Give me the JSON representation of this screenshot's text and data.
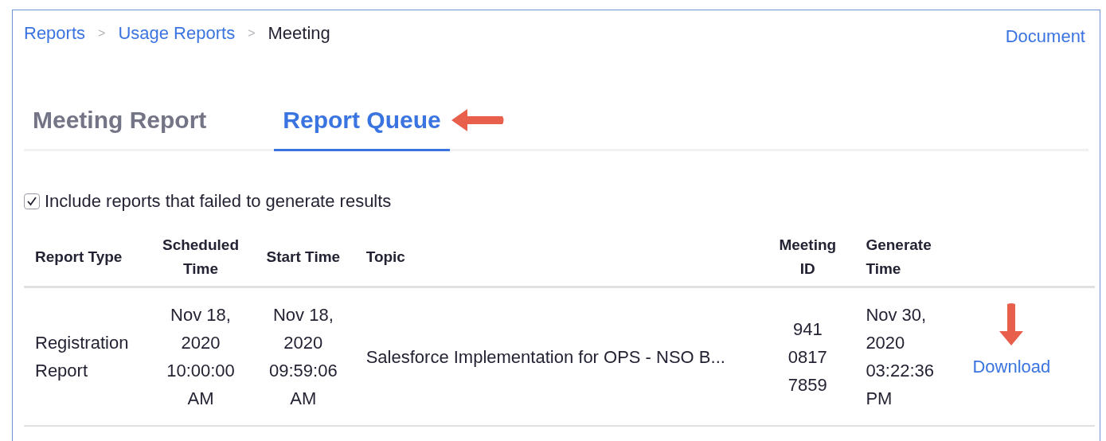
{
  "breadcrumb": [
    {
      "label": "Reports",
      "kind": "link"
    },
    {
      "label": "Usage Reports",
      "kind": "link"
    },
    {
      "label": "Meeting",
      "kind": "current"
    }
  ],
  "separator": ">",
  "document_link": "Document",
  "tabs": [
    {
      "label": "Meeting Report",
      "selected": false
    },
    {
      "label": "Report Queue",
      "selected": true
    }
  ],
  "include_failed": {
    "label": "Include reports that failed to generate results",
    "checked": true
  },
  "table": {
    "columns": [
      "Report Type",
      "Scheduled Time",
      "Start Time",
      "Topic",
      "Meeting ID",
      "Generate Time"
    ],
    "rows": [
      {
        "report_type": "Registration Report",
        "scheduled_time": "Nov 18, 2020 10:00:00 AM",
        "start_time": "Nov 18, 2020 09:59:06 AM",
        "topic": "Salesforce Implementation for OPS - NSO B...",
        "meeting_id": "941 0817 7859",
        "generate_time": "Nov 30, 2020 03:22:36 PM",
        "action": "Download"
      }
    ]
  }
}
